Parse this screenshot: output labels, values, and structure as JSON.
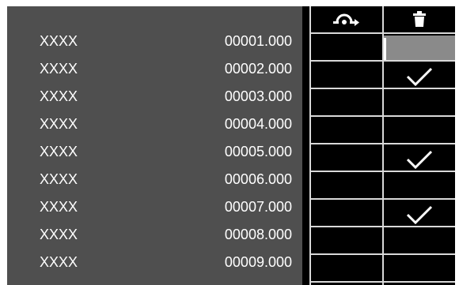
{
  "header": {
    "column_icons": [
      "skip-arrow-icon",
      "trash-icon"
    ]
  },
  "rows": [
    {
      "name": "XXXX",
      "value": "00001.000",
      "skip": false,
      "delete": false,
      "selected": true
    },
    {
      "name": "XXXX",
      "value": "00002.000",
      "skip": false,
      "delete": true,
      "selected": false
    },
    {
      "name": "XXXX",
      "value": "00003.000",
      "skip": false,
      "delete": false,
      "selected": false
    },
    {
      "name": "XXXX",
      "value": "00004.000",
      "skip": false,
      "delete": false,
      "selected": false
    },
    {
      "name": "XXXX",
      "value": "00005.000",
      "skip": false,
      "delete": true,
      "selected": false
    },
    {
      "name": "XXXX",
      "value": "00006.000",
      "skip": false,
      "delete": false,
      "selected": false
    },
    {
      "name": "XXXX",
      "value": "00007.000",
      "skip": false,
      "delete": true,
      "selected": false
    },
    {
      "name": "XXXX",
      "value": "00008.000",
      "skip": false,
      "delete": false,
      "selected": false
    },
    {
      "name": "XXXX",
      "value": "00009.000",
      "skip": false,
      "delete": false,
      "selected": false
    }
  ],
  "colors": {
    "panel": "#4f4f4f",
    "background": "#000000",
    "grid_line": "#d9d9d9",
    "selected_cell": "#8a8a8a",
    "text": "#ffffff"
  }
}
